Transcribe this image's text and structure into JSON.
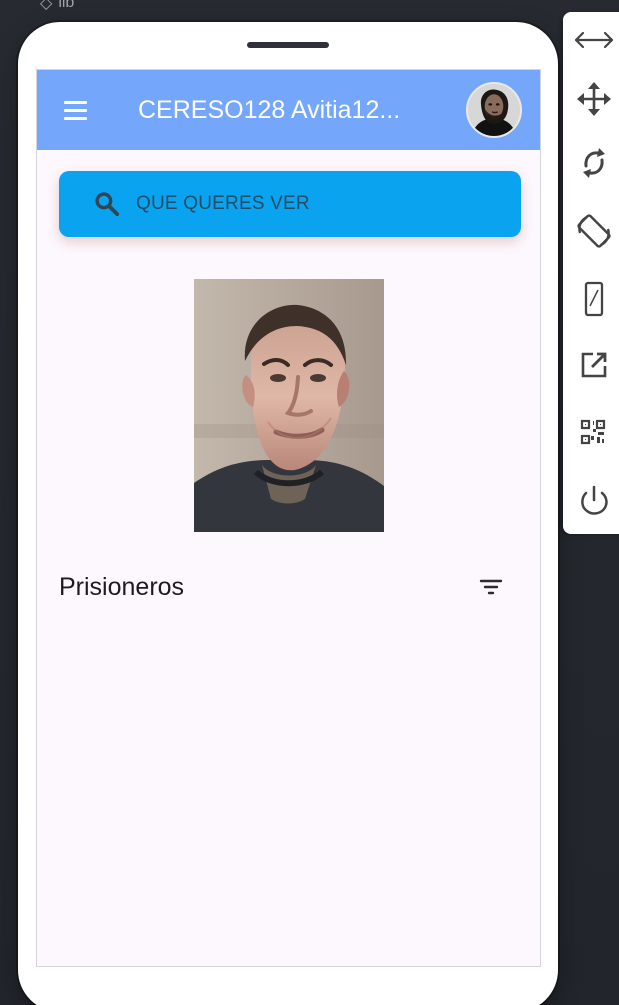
{
  "window": {
    "top_fragment": "lib"
  },
  "app_bar": {
    "title": "CERESO128 Avitia12..."
  },
  "search": {
    "placeholder": "QUE QUERES VER",
    "value": ""
  },
  "section": {
    "title": "Prisioneros"
  },
  "icons": {
    "menu": "menu-icon",
    "profile": "profile-avatar",
    "search": "search-icon",
    "filter": "filter-icon",
    "tools": [
      "resize-horizontal-icon",
      "move-icon",
      "rotate-icon",
      "rotate-device-icon",
      "device-frame-icon",
      "open-external-icon",
      "qr-code-icon",
      "power-icon"
    ]
  },
  "colors": {
    "app_bar": "#74a6fb",
    "search_background": "#0aa3f0",
    "screen_background": "#fdf8fe",
    "toolbar_background": "#ffffff",
    "dark_background": "#22262c"
  }
}
